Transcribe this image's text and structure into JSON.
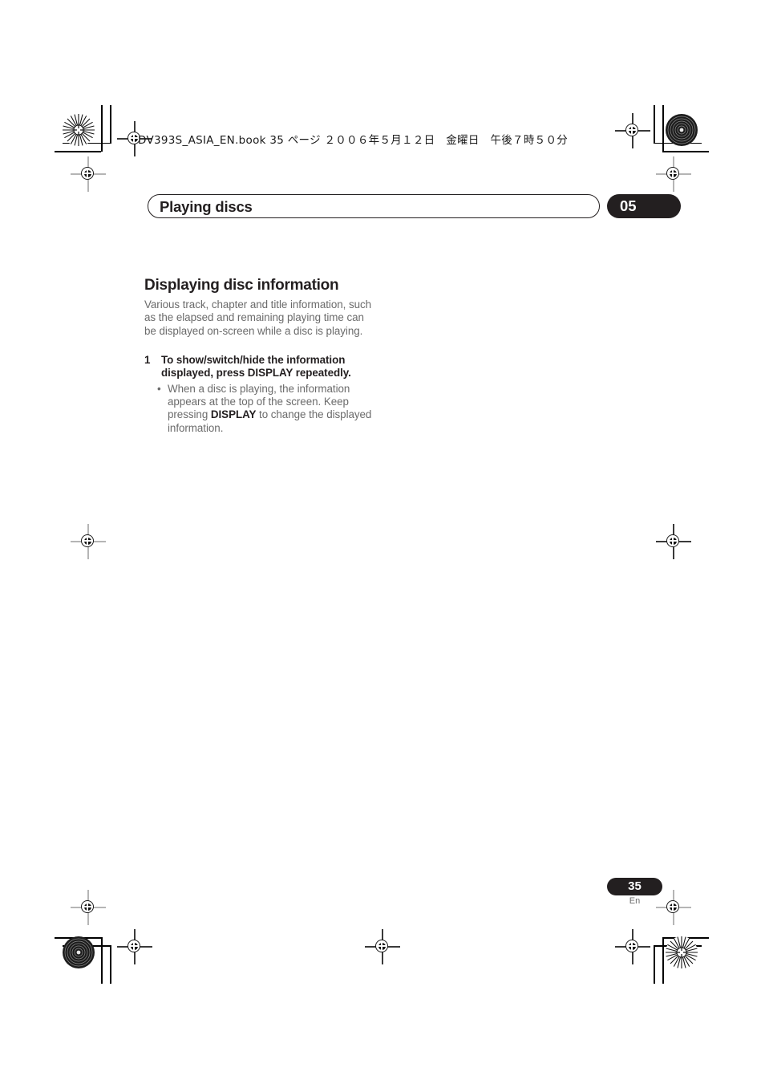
{
  "document": {
    "file_header": "DV393S_ASIA_EN.book  35 ページ  ２００６年５月１２日　金曜日　午後７時５０分",
    "chapter": {
      "title": "Playing discs",
      "number": "05"
    },
    "section": {
      "heading": "Displaying disc information",
      "intro": "Various track, chapter and title information, such as the elapsed and remaining playing time can be displayed on-screen while a disc is playing.",
      "steps": [
        {
          "number": "1",
          "text": "To show/switch/hide the information displayed, press DISPLAY repeatedly."
        }
      ],
      "bullets": [
        {
          "marker": "•",
          "text_before": "When a disc is playing, the information appears at the top of the screen. Keep pressing ",
          "emphasis": "DISPLAY",
          "text_after": " to change the displayed information."
        }
      ]
    },
    "footer": {
      "page_number": "35",
      "language": "En"
    },
    "colors": {
      "ink": "#231f20",
      "body_text": "#6b6b6b",
      "registration": "#b5b5b5",
      "paper": "#ffffff"
    }
  }
}
